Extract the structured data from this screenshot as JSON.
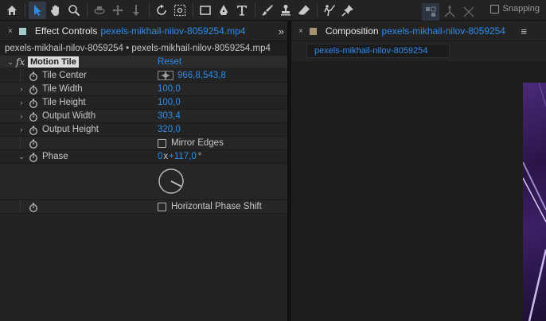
{
  "toolbar": {
    "tools": [
      {
        "name": "home-icon",
        "active": false
      },
      {
        "name": "selection-tool-icon",
        "active": true
      },
      {
        "name": "hand-tool-icon",
        "active": false
      },
      {
        "name": "zoom-tool-icon",
        "active": false
      },
      {
        "name": "orbit-camera-icon",
        "active": false
      },
      {
        "name": "pan-camera-icon",
        "active": false
      },
      {
        "name": "dolly-camera-icon",
        "active": false
      },
      {
        "name": "rotation-tool-icon",
        "active": false
      },
      {
        "name": "pan-behind-tool-icon",
        "active": false
      },
      {
        "name": "rectangle-tool-icon",
        "active": false
      },
      {
        "name": "pen-tool-icon",
        "active": false
      },
      {
        "name": "type-tool-icon",
        "active": false
      },
      {
        "name": "brush-tool-icon",
        "active": false
      },
      {
        "name": "clone-stamp-tool-icon",
        "active": false
      },
      {
        "name": "eraser-tool-icon",
        "active": false
      },
      {
        "name": "roto-brush-tool-icon",
        "active": false
      },
      {
        "name": "puppet-pin-tool-icon",
        "active": false
      }
    ],
    "snapping_label": "Snapping",
    "snapping_checked": false
  },
  "left_panel": {
    "close_glyph": "×",
    "tab_title": "Effect Controls",
    "tab_file": "pexels-mikhail-nilov-8059254.mp4",
    "swatch_color": "#a3c9c9",
    "expand_glyph": "»",
    "breadcrumb": "pexels-mikhail-nilov-8059254 • pexels-mikhail-nilov-8059254.mp4",
    "effect": {
      "fx_glyph": "fx",
      "name": "Motion Tile",
      "reset_label": "Reset"
    },
    "properties": {
      "tile_center": {
        "label": "Tile Center",
        "value": "966,8,543,8"
      },
      "tile_width": {
        "label": "Tile Width",
        "value": "100,0"
      },
      "tile_height": {
        "label": "Tile Height",
        "value": "100,0"
      },
      "output_width": {
        "label": "Output Width",
        "value": "303,4"
      },
      "output_height": {
        "label": "Output Height",
        "value": "320,0"
      },
      "mirror_edges": {
        "label": "Mirror Edges",
        "checked": false
      },
      "phase": {
        "label": "Phase",
        "revolutions": "0",
        "times": "x",
        "degrees": "+117,0",
        "degree_sign": "°",
        "angle_deg": 117
      },
      "horizontal_phase_shift": {
        "label": "Horizontal Phase Shift",
        "checked": false
      }
    }
  },
  "right_panel": {
    "close_glyph": "×",
    "tab_title": "Composition",
    "tab_file": "pexels-mikhail-nilov-8059254",
    "swatch_color": "#a39370",
    "menu_glyph": "≡",
    "subtab_label": "pexels-mikhail-nilov-8059254"
  },
  "colors": {
    "accent_blue": "#2d8ceb",
    "panel_bg": "#232323",
    "app_bg": "#1d1d1d",
    "preview_purple": "#3c1f66"
  }
}
